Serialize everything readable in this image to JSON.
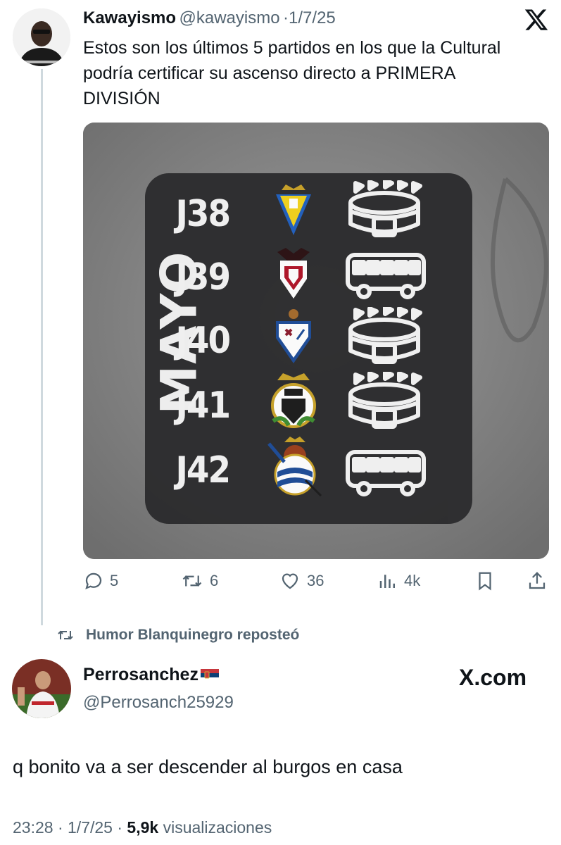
{
  "quoted_tweet": {
    "author_name": "Kawayismo",
    "author_handle": "@kawayismo",
    "separator": "·",
    "date": "1/7/25",
    "text": "Estos son los últimos 5 partidos en los que la Cultural podría certificar su ascenso directo a PRIMERA DIVISIÓN",
    "media": {
      "month_label": "MAYO",
      "fixtures": [
        {
          "round": "J38",
          "crest": "cadiz-crest-icon",
          "venue": "stadium-icon"
        },
        {
          "round": "J39",
          "crest": "albacete-crest-icon",
          "venue": "bus-icon"
        },
        {
          "round": "J40",
          "crest": "eibar-crest-icon",
          "venue": "stadium-icon"
        },
        {
          "round": "J41",
          "crest": "burgos-crest-icon",
          "venue": "stadium-icon"
        },
        {
          "round": "J42",
          "crest": "real-sociedad-b-crest-icon",
          "venue": "bus-icon"
        }
      ]
    },
    "actions": {
      "replies": "5",
      "reposts": "6",
      "likes": "36",
      "views": "4k"
    }
  },
  "repost_notice": "Humor Blanquinegro reposteó",
  "reply_tweet": {
    "author_name": "Perrosanchez",
    "author_handle": "@Perrosanch25929",
    "watermark": "X.com",
    "text": "q bonito va a ser descender al burgos en casa",
    "time": "23:28",
    "separator": "·",
    "date": "1/7/25",
    "views_count": "5,9k",
    "views_label": "visualizaciones"
  },
  "colors": {
    "text": "#0f1419",
    "muted": "#536471",
    "thread_line": "#cfd9de",
    "card": "#2c2c2e"
  }
}
